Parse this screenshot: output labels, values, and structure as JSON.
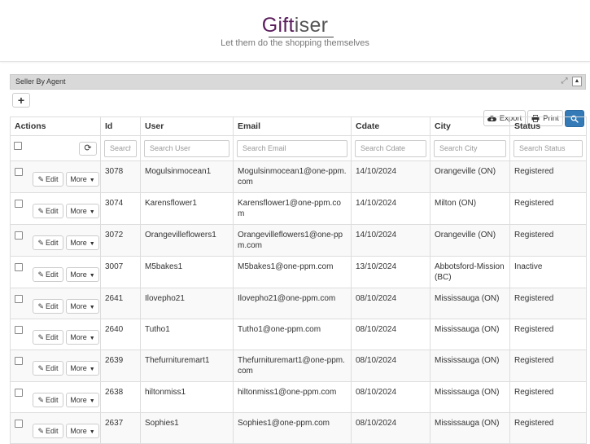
{
  "header": {
    "logo_part1": "Gift",
    "logo_part2": "iser",
    "tagline": "Let them do the shopping themselves"
  },
  "panel": {
    "title": "Seller By Agent",
    "add_label": "+",
    "export_label": "Export",
    "print_label": "Print"
  },
  "table": {
    "headers": [
      "Actions",
      "Id",
      "User",
      "Email",
      "Cdate",
      "City",
      "Status"
    ],
    "placeholders": {
      "id": "Search Id",
      "user": "Search User",
      "email": "Search Email",
      "cdate": "Search Cdate",
      "city": "Search City",
      "status": "Search Status"
    },
    "edit_label": "Edit",
    "more_label": "More",
    "rows": [
      {
        "id": "3078",
        "user": "Mogulsinmocean1",
        "email": "Mogulsinmocean1@one-ppm.com",
        "cdate": "14/10/2024",
        "city": "Orangeville (ON)",
        "status": "Registered"
      },
      {
        "id": "3074",
        "user": "Karensflower1",
        "email": "Karensflower1@one-ppm.com",
        "cdate": "14/10/2024",
        "city": "Milton (ON)",
        "status": "Registered"
      },
      {
        "id": "3072",
        "user": "Orangevilleflowers1",
        "email": "Orangevilleflowers1@one-ppm.com",
        "cdate": "14/10/2024",
        "city": "Orangeville (ON)",
        "status": "Registered"
      },
      {
        "id": "3007",
        "user": "M5bakes1",
        "email": "M5bakes1@one-ppm.com",
        "cdate": "13/10/2024",
        "city": "Abbotsford-Mission (BC)",
        "status": "Inactive"
      },
      {
        "id": "2641",
        "user": "Ilovepho21",
        "email": "Ilovepho21@one-ppm.com",
        "cdate": "08/10/2024",
        "city": "Mississauga (ON)",
        "status": "Registered"
      },
      {
        "id": "2640",
        "user": "Tutho1",
        "email": "Tutho1@one-ppm.com",
        "cdate": "08/10/2024",
        "city": "Mississauga (ON)",
        "status": "Registered"
      },
      {
        "id": "2639",
        "user": "Thefurnituremart1",
        "email": "Thefurnituremart1@one-ppm.com",
        "cdate": "08/10/2024",
        "city": "Mississauga (ON)",
        "status": "Registered"
      },
      {
        "id": "2638",
        "user": "hiltonmiss1",
        "email": "hiltonmiss1@one-ppm.com",
        "cdate": "08/10/2024",
        "city": "Mississauga (ON)",
        "status": "Registered"
      },
      {
        "id": "2637",
        "user": "Sophies1",
        "email": "Sophies1@one-ppm.com",
        "cdate": "08/10/2024",
        "city": "Mississauga (ON)",
        "status": "Registered"
      }
    ]
  },
  "icons": {
    "export": "cloud-download-icon",
    "print": "print-icon",
    "search": "search-icon",
    "refresh": "refresh-icon",
    "edit": "pencil-icon",
    "expand": "expand-icon",
    "collapse": "chevron-up-icon"
  },
  "colors": {
    "brand": "#5a1e5c",
    "primary_button": "#337ab7"
  }
}
